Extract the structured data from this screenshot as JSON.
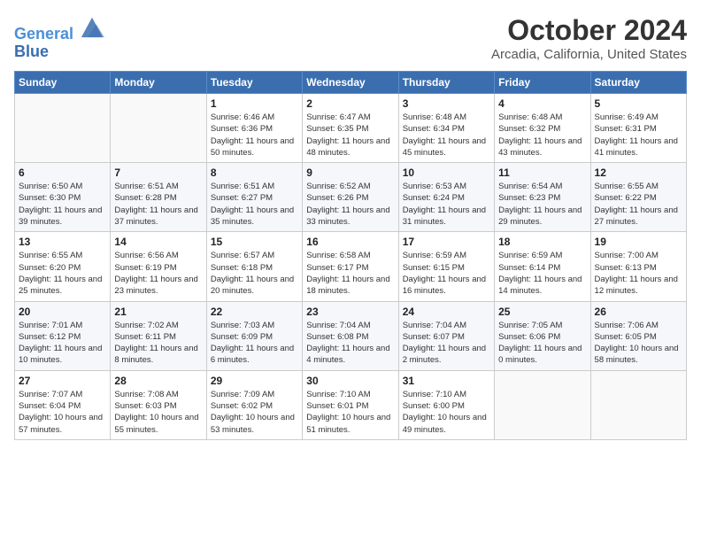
{
  "header": {
    "logo_line1": "General",
    "logo_line2": "Blue",
    "title": "October 2024",
    "subtitle": "Arcadia, California, United States"
  },
  "weekdays": [
    "Sunday",
    "Monday",
    "Tuesday",
    "Wednesday",
    "Thursday",
    "Friday",
    "Saturday"
  ],
  "weeks": [
    [
      {
        "day": "",
        "info": ""
      },
      {
        "day": "",
        "info": ""
      },
      {
        "day": "1",
        "info": "Sunrise: 6:46 AM\nSunset: 6:36 PM\nDaylight: 11 hours and 50 minutes."
      },
      {
        "day": "2",
        "info": "Sunrise: 6:47 AM\nSunset: 6:35 PM\nDaylight: 11 hours and 48 minutes."
      },
      {
        "day": "3",
        "info": "Sunrise: 6:48 AM\nSunset: 6:34 PM\nDaylight: 11 hours and 45 minutes."
      },
      {
        "day": "4",
        "info": "Sunrise: 6:48 AM\nSunset: 6:32 PM\nDaylight: 11 hours and 43 minutes."
      },
      {
        "day": "5",
        "info": "Sunrise: 6:49 AM\nSunset: 6:31 PM\nDaylight: 11 hours and 41 minutes."
      }
    ],
    [
      {
        "day": "6",
        "info": "Sunrise: 6:50 AM\nSunset: 6:30 PM\nDaylight: 11 hours and 39 minutes."
      },
      {
        "day": "7",
        "info": "Sunrise: 6:51 AM\nSunset: 6:28 PM\nDaylight: 11 hours and 37 minutes."
      },
      {
        "day": "8",
        "info": "Sunrise: 6:51 AM\nSunset: 6:27 PM\nDaylight: 11 hours and 35 minutes."
      },
      {
        "day": "9",
        "info": "Sunrise: 6:52 AM\nSunset: 6:26 PM\nDaylight: 11 hours and 33 minutes."
      },
      {
        "day": "10",
        "info": "Sunrise: 6:53 AM\nSunset: 6:24 PM\nDaylight: 11 hours and 31 minutes."
      },
      {
        "day": "11",
        "info": "Sunrise: 6:54 AM\nSunset: 6:23 PM\nDaylight: 11 hours and 29 minutes."
      },
      {
        "day": "12",
        "info": "Sunrise: 6:55 AM\nSunset: 6:22 PM\nDaylight: 11 hours and 27 minutes."
      }
    ],
    [
      {
        "day": "13",
        "info": "Sunrise: 6:55 AM\nSunset: 6:20 PM\nDaylight: 11 hours and 25 minutes."
      },
      {
        "day": "14",
        "info": "Sunrise: 6:56 AM\nSunset: 6:19 PM\nDaylight: 11 hours and 23 minutes."
      },
      {
        "day": "15",
        "info": "Sunrise: 6:57 AM\nSunset: 6:18 PM\nDaylight: 11 hours and 20 minutes."
      },
      {
        "day": "16",
        "info": "Sunrise: 6:58 AM\nSunset: 6:17 PM\nDaylight: 11 hours and 18 minutes."
      },
      {
        "day": "17",
        "info": "Sunrise: 6:59 AM\nSunset: 6:15 PM\nDaylight: 11 hours and 16 minutes."
      },
      {
        "day": "18",
        "info": "Sunrise: 6:59 AM\nSunset: 6:14 PM\nDaylight: 11 hours and 14 minutes."
      },
      {
        "day": "19",
        "info": "Sunrise: 7:00 AM\nSunset: 6:13 PM\nDaylight: 11 hours and 12 minutes."
      }
    ],
    [
      {
        "day": "20",
        "info": "Sunrise: 7:01 AM\nSunset: 6:12 PM\nDaylight: 11 hours and 10 minutes."
      },
      {
        "day": "21",
        "info": "Sunrise: 7:02 AM\nSunset: 6:11 PM\nDaylight: 11 hours and 8 minutes."
      },
      {
        "day": "22",
        "info": "Sunrise: 7:03 AM\nSunset: 6:09 PM\nDaylight: 11 hours and 6 minutes."
      },
      {
        "day": "23",
        "info": "Sunrise: 7:04 AM\nSunset: 6:08 PM\nDaylight: 11 hours and 4 minutes."
      },
      {
        "day": "24",
        "info": "Sunrise: 7:04 AM\nSunset: 6:07 PM\nDaylight: 11 hours and 2 minutes."
      },
      {
        "day": "25",
        "info": "Sunrise: 7:05 AM\nSunset: 6:06 PM\nDaylight: 11 hours and 0 minutes."
      },
      {
        "day": "26",
        "info": "Sunrise: 7:06 AM\nSunset: 6:05 PM\nDaylight: 10 hours and 58 minutes."
      }
    ],
    [
      {
        "day": "27",
        "info": "Sunrise: 7:07 AM\nSunset: 6:04 PM\nDaylight: 10 hours and 57 minutes."
      },
      {
        "day": "28",
        "info": "Sunrise: 7:08 AM\nSunset: 6:03 PM\nDaylight: 10 hours and 55 minutes."
      },
      {
        "day": "29",
        "info": "Sunrise: 7:09 AM\nSunset: 6:02 PM\nDaylight: 10 hours and 53 minutes."
      },
      {
        "day": "30",
        "info": "Sunrise: 7:10 AM\nSunset: 6:01 PM\nDaylight: 10 hours and 51 minutes."
      },
      {
        "day": "31",
        "info": "Sunrise: 7:10 AM\nSunset: 6:00 PM\nDaylight: 10 hours and 49 minutes."
      },
      {
        "day": "",
        "info": ""
      },
      {
        "day": "",
        "info": ""
      }
    ]
  ]
}
